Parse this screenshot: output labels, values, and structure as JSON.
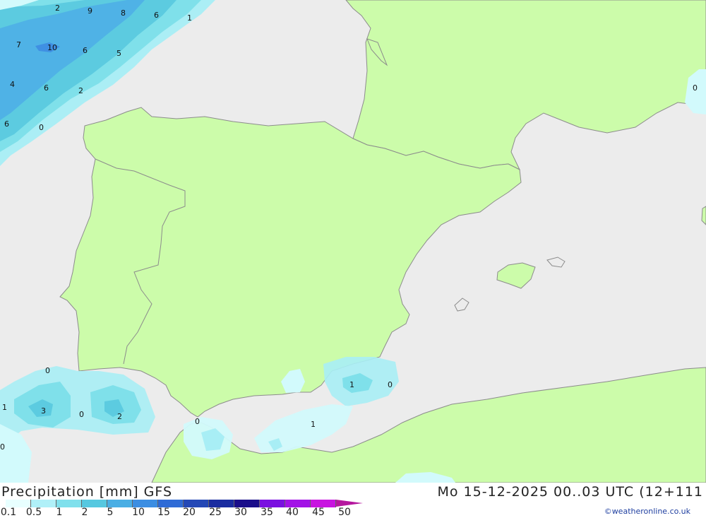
{
  "title": "Precipitation [mm] GFS",
  "datetime": "Mo 15-12-2025 00..03 UTC (12+111",
  "credit": "©weatheronline.co.uk",
  "colors": {
    "sea": "#ececec",
    "land": "#ccfcaa",
    "coast": "#8c8c8c",
    "precip": [
      "#d2fafc",
      "#a8eef5",
      "#7fe0ea",
      "#5ccbe0",
      "#4fb2e6",
      "#3f90e3",
      "#3570d8",
      "#2550b8",
      "#1b31a5",
      "#0c1a8e",
      "#7a10e3",
      "#a010e8",
      "#c914e0",
      "#e61ce0",
      "#c414a8",
      "#9c0c88"
    ]
  },
  "scale": {
    "labels": [
      "0.1",
      "0.5",
      "1",
      "2",
      "5",
      "10",
      "15",
      "20",
      "25",
      "30",
      "35",
      "40",
      "45",
      "50"
    ],
    "swatches": [
      "#e8ffff",
      "#b0f0f8",
      "#80e0ec",
      "#56c8e0",
      "#4aaee4",
      "#3c8ee2",
      "#2f6bd6",
      "#2448b6",
      "#1a2ca0",
      "#1a0e8a",
      "#7a10e0",
      "#a212e6",
      "#c814e0",
      "#e41ce0"
    ],
    "arrow_color": "#b5179e"
  },
  "map_labels": [
    {
      "name": "label-2-a",
      "text": "2"
    },
    {
      "name": "label-9",
      "text": "9"
    },
    {
      "name": "label-8",
      "text": "8"
    },
    {
      "name": "label-6-a",
      "text": "6"
    },
    {
      "name": "label-1-a",
      "text": "1"
    },
    {
      "name": "label-7",
      "text": "7"
    },
    {
      "name": "label-10",
      "text": "10"
    },
    {
      "name": "label-6-b",
      "text": "6"
    },
    {
      "name": "label-5",
      "text": "5"
    },
    {
      "name": "label-4",
      "text": "4"
    },
    {
      "name": "label-6-c",
      "text": "6"
    },
    {
      "name": "label-2-b",
      "text": "2"
    },
    {
      "name": "label-6-d",
      "text": "6"
    },
    {
      "name": "label-0-a",
      "text": "0"
    },
    {
      "name": "label-0-b",
      "text": "0"
    },
    {
      "name": "label-0-c",
      "text": "0"
    },
    {
      "name": "label-1-b",
      "text": "1"
    },
    {
      "name": "label-3",
      "text": "3"
    },
    {
      "name": "label-0-d",
      "text": "0"
    },
    {
      "name": "label-2-c",
      "text": "2"
    },
    {
      "name": "label-0-e",
      "text": "0"
    },
    {
      "name": "label-1-c",
      "text": "1"
    },
    {
      "name": "label-0-f",
      "text": "0"
    },
    {
      "name": "label-1-d",
      "text": "1"
    },
    {
      "name": "label-0-g",
      "text": "0"
    }
  ]
}
